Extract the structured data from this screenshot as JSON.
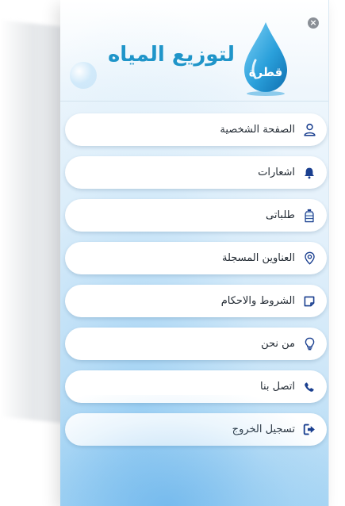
{
  "header": {
    "close_glyph": "×",
    "logo_text": "لتوزيع المياه",
    "logo_mark_text": "قطرة"
  },
  "colors": {
    "accent": "#1f95c9",
    "icon": "#1a3f8f",
    "item_text": "#222a33"
  },
  "menu": {
    "items": [
      {
        "label": "الصفحة الشخصية",
        "icon": "user-icon"
      },
      {
        "label": "اشعارات",
        "icon": "bell-icon"
      },
      {
        "label": "طلباتى",
        "icon": "water-bottle-icon"
      },
      {
        "label": "العناوين المسجلة",
        "icon": "map-pin-icon"
      },
      {
        "label": "الشروط والاحكام",
        "icon": "note-icon"
      },
      {
        "label": "من نحن",
        "icon": "lightbulb-icon"
      },
      {
        "label": "اتصل بنا",
        "icon": "phone-icon"
      },
      {
        "label": "تسجيل الخروج",
        "icon": "sign-out-icon"
      }
    ]
  }
}
